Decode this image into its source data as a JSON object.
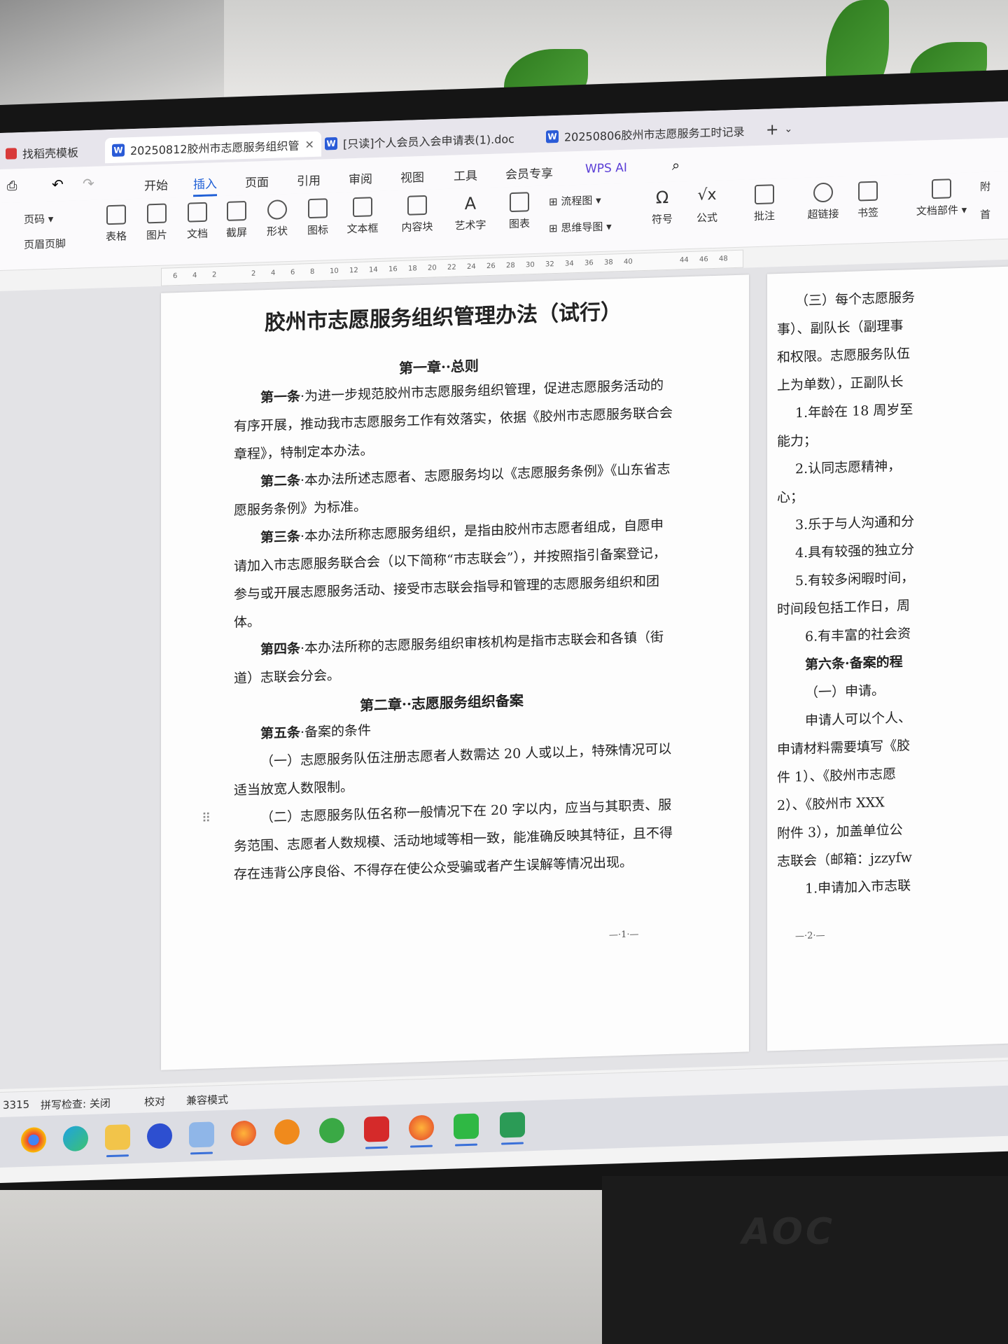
{
  "tabs": [
    {
      "label": "找稻壳模板",
      "icon": "docer-icon"
    },
    {
      "label": "20250812胶州市志愿服务组织管",
      "icon": "word-doc-icon",
      "active": true
    },
    {
      "label": "[只读]个人会员入会申请表(1).doc",
      "icon": "word-doc-icon"
    },
    {
      "label": "20250806胶州市志愿服务工时记录",
      "icon": "word-doc-icon"
    }
  ],
  "menus": [
    "开始",
    "插入",
    "页面",
    "引用",
    "审阅",
    "视图",
    "工具",
    "会员专享",
    "WPS AI"
  ],
  "active_menu": "插入",
  "ribbon": {
    "left": [
      "页码",
      "页眉页脚"
    ],
    "buttons": [
      "表格",
      "图片",
      "文档",
      "截屏",
      "形状",
      "图标",
      "文本框",
      "内容块",
      "艺术字",
      "图表"
    ],
    "flow": [
      "流程图",
      "思维导图"
    ],
    "right": [
      "符号",
      "公式",
      "批注",
      "超链接",
      "书签",
      "文档部件"
    ],
    "edge": [
      "附",
      "首"
    ]
  },
  "ruler_ticks": [
    "6",
    "4",
    "2",
    "2",
    "4",
    "6",
    "8",
    "10",
    "12",
    "14",
    "16",
    "18",
    "20",
    "22",
    "24",
    "26",
    "28",
    "30",
    "32",
    "34",
    "36",
    "38",
    "40",
    "44",
    "46",
    "48"
  ],
  "page1": {
    "title": "胶州市志愿服务组织管理办法（试行）",
    "chapter1": "第一章··总则",
    "a1_head": "第一条",
    "a1_text": "·为进一步规范胶州市志愿服务组织管理，促进志愿服务活动的有序开展，推动我市志愿服务工作有效落实，依据《胶州市志愿服务联合会章程》，特制定本办法。",
    "a2_head": "第二条",
    "a2_text": "·本办法所述志愿者、志愿服务均以《志愿服务条例》《山东省志愿服务条例》为标准。",
    "a3_head": "第三条",
    "a3_text": "·本办法所称志愿服务组织，是指由胶州市志愿者组成，自愿申请加入市志愿服务联合会（以下简称“市志联会”），并按照指引备案登记，参与或开展志愿服务活动、接受市志联会指导和管理的志愿服务组织和团体。",
    "a4_head": "第四条",
    "a4_text": "·本办法所称的志愿服务组织审核机构是指市志联会和各镇（街道）志联会分会。",
    "chapter2": "第二章··志愿服务组织备案",
    "a5_head": "第五条",
    "a5_text": "·备案的条件",
    "item1": "（一）志愿服务队伍注册志愿者人数需达 20 人或以上，特殊情况可以适当放宽人数限制。",
    "item2": "（二）志愿服务队伍名称一般情况下在 20 字以内，应当与其职责、服务范围、志愿者人数规模、活动地域等相一致，能准确反映其特征，且不得存在违背公序良俗、不得存在使公众受骗或者产生误解等情况出现。",
    "page_number": "—·1·—"
  },
  "page2": {
    "lines": [
      "（三）每个志愿服务",
      "事）、副队长（副理事",
      "和权限。志愿服务队伍",
      "上为单数），正副队长",
      "1.年龄在 18 周岁至",
      "能力；",
      "2.认同志愿精神，",
      "心；",
      "3.乐于与人沟通和分",
      "4.具有较强的独立分",
      "5.有较多闲暇时间，",
      "时间段包括工作日，周",
      "6.有丰富的社会资",
      "第六条·备案的程",
      "（一）申请。",
      "申请人可以个人、",
      "申请材料需要填写《胶",
      "件 1）、《胶州市志愿",
      "2）、《胶州市 XXX",
      "附件 3），加盖单位公",
      "志联会（邮箱：jzzyfw",
      "1.申请加入市志联"
    ],
    "page_number": "—·2·—"
  },
  "statusbar": {
    "words": "3315",
    "spell": "拼写检查: 关闭",
    "proof": "校对",
    "compat": "兼容模式"
  },
  "taskbar": [
    "chrome-icon",
    "edge-icon",
    "file-explorer-icon",
    "app-icon",
    "photos-icon",
    "firefox-icon",
    "search-icon",
    "ie-icon",
    "wps-icon",
    "firefox-icon",
    "wechat-icon",
    "remote-icon"
  ],
  "brand": "AOC"
}
